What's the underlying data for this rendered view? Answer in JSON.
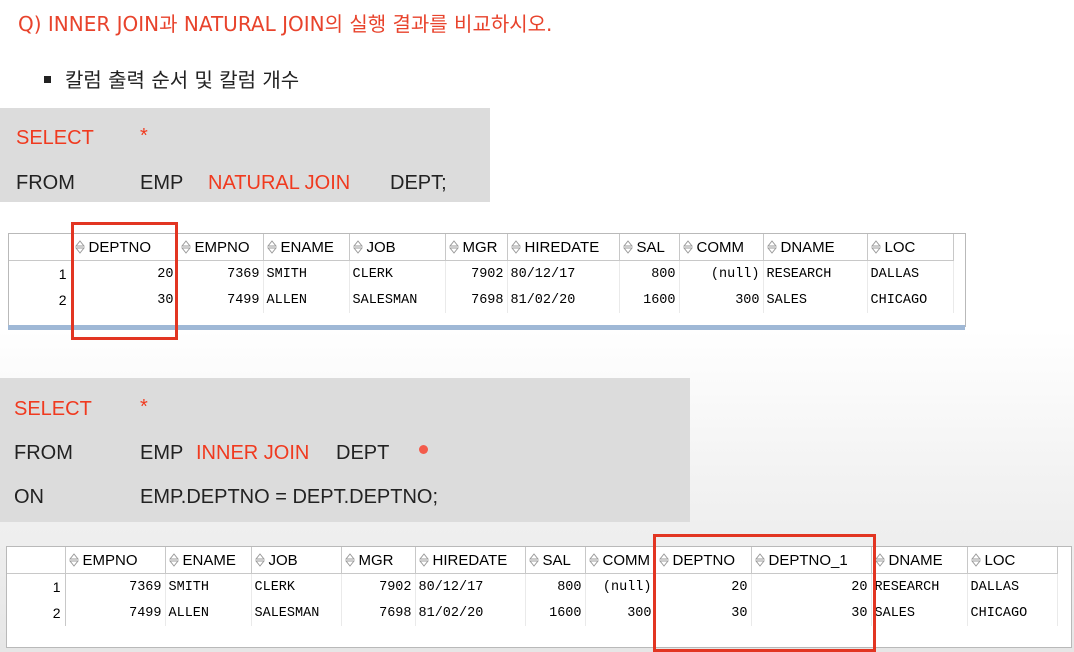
{
  "title": "Q) INNER JOIN과 NATURAL JOIN의 실행 결과를 비교하시오.",
  "bullet": "칼럼 출력 순서 및 칼럼 개수",
  "colors": {
    "accent_red": "#e8432c",
    "code_bg": "#dcdcdc",
    "grid_bar": "#9fb8d6"
  },
  "query1": {
    "select_kw": "SELECT",
    "star": "*",
    "from_kw": "FROM",
    "left_table": "EMP",
    "join_kw": "NATURAL JOIN",
    "right_table": "DEPT;"
  },
  "grid1": {
    "headers": [
      "DEPTNO",
      "EMPNO",
      "ENAME",
      "JOB",
      "MGR",
      "HIREDATE",
      "SAL",
      "COMM",
      "DNAME",
      "LOC"
    ],
    "rows": [
      [
        "1",
        "20",
        "7369",
        "SMITH",
        "CLERK",
        "7902",
        "80/12/17",
        "800",
        "(null)",
        "RESEARCH",
        "DALLAS"
      ],
      [
        "2",
        "30",
        "7499",
        "ALLEN",
        "SALESMAN",
        "7698",
        "81/02/20",
        "1600",
        "300",
        "SALES",
        "CHICAGO"
      ]
    ]
  },
  "query2": {
    "select_kw": "SELECT",
    "star": "*",
    "from_kw": "FROM",
    "left_table": "EMP",
    "join_kw": "INNER JOIN",
    "right_table": "DEPT",
    "on_kw": "ON",
    "condition": "EMP.DEPTNO = DEPT.DEPTNO;"
  },
  "grid2": {
    "headers": [
      "EMPNO",
      "ENAME",
      "JOB",
      "MGR",
      "HIREDATE",
      "SAL",
      "COMM",
      "DEPTNO",
      "DEPTNO_1",
      "DNAME",
      "LOC"
    ],
    "rows": [
      [
        "1",
        "7369",
        "SMITH",
        "CLERK",
        "7902",
        "80/12/17",
        "800",
        "(null)",
        "20",
        "20",
        "RESEARCH",
        "DALLAS"
      ],
      [
        "2",
        "7499",
        "ALLEN",
        "SALESMAN",
        "7698",
        "81/02/20",
        "1600",
        "300",
        "30",
        "30",
        "SALES",
        "CHICAGO"
      ]
    ]
  }
}
